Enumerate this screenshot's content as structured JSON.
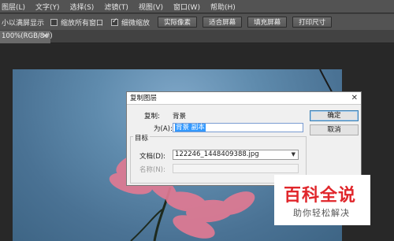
{
  "menu": [
    "图层(L)",
    "文字(Y)",
    "选择(S)",
    "滤镜(T)",
    "视图(V)",
    "窗口(W)",
    "帮助(H)"
  ],
  "options": {
    "fit_label": "小以满屏显示",
    "zoom_all_windows": "缩放所有窗口",
    "scrubby_zoom": "细微缩放",
    "scrubby_zoom_checked": true,
    "zoom_all_checked": false,
    "buttons": [
      "实际像素",
      "适合屏幕",
      "填充屏幕",
      "打印尺寸"
    ]
  },
  "tab": {
    "label": "100%(RGB/8#)",
    "close": "×"
  },
  "dialog": {
    "title": "复制图层",
    "copy_label": "复制:",
    "copy_value": "背景",
    "as_label": "为(A):",
    "as_value": "背景 副本",
    "target_group": "目标",
    "document_label": "文档(D):",
    "document_value": "122246_1448409388.jpg",
    "name_label": "名称(N):",
    "name_value": "",
    "ok_button": "确定",
    "cancel_button": "取消",
    "close": "✕"
  },
  "watermark": {
    "title": "百科全说",
    "subtitle": "助你轻松解决",
    "color": "#e0262b"
  }
}
